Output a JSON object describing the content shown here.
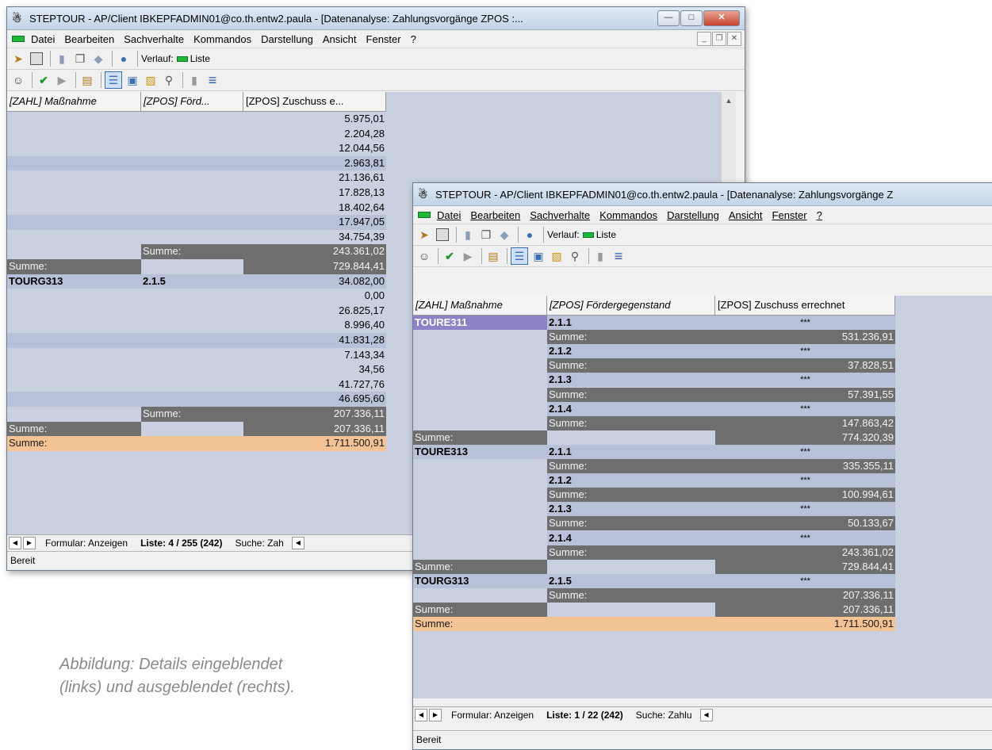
{
  "left_window": {
    "title": "STEPTOUR - AP/Client IBKEPFADMIN01@co.th.entw2.paula - [Datenanalyse: Zahlungsvorgänge ZPOS :...",
    "menu": [
      "Datei",
      "Bearbeiten",
      "Sachverhalte",
      "Kommandos",
      "Darstellung",
      "Ansicht",
      "Fenster",
      "?"
    ],
    "verlauf_label": "Verlauf:",
    "verlauf_value": "Liste",
    "columns": [
      "[ZAHL] Maßnahme",
      "[ZPOS] Förd...",
      "[ZPOS] Zuschuss e..."
    ],
    "rows": [
      {
        "c1": "",
        "c2": "",
        "c3": "5.975,01",
        "style": "lt"
      },
      {
        "c1": "",
        "c2": "",
        "c3": "2.204,28",
        "style": "lt"
      },
      {
        "c1": "",
        "c2": "",
        "c3": "12.044,56",
        "style": "lt"
      },
      {
        "c1": "",
        "c2": "",
        "c3": "2.963,81",
        "style": "st"
      },
      {
        "c1": "",
        "c2": "",
        "c3": "21.136,61",
        "style": "lt"
      },
      {
        "c1": "",
        "c2": "",
        "c3": "17.828,13",
        "style": "lt"
      },
      {
        "c1": "",
        "c2": "",
        "c3": "18.402,64",
        "style": "lt"
      },
      {
        "c1": "",
        "c2": "",
        "c3": "17.947,05",
        "style": "st"
      },
      {
        "c1": "",
        "c2": "",
        "c3": "34.754,39",
        "style": "lt"
      },
      {
        "c1": "",
        "c2": "Summe:",
        "c3": "243.361,02",
        "style": "sum2"
      },
      {
        "c1": "Summe:",
        "c2": "",
        "c3": "729.844,41",
        "style": "sum1"
      },
      {
        "c1": "TOURG313",
        "c2": "2.1.5",
        "c3": "34.082,00",
        "style": "head"
      },
      {
        "c1": "",
        "c2": "",
        "c3": "0,00",
        "style": "lt"
      },
      {
        "c1": "",
        "c2": "",
        "c3": "26.825,17",
        "style": "lt"
      },
      {
        "c1": "",
        "c2": "",
        "c3": "8.996,40",
        "style": "lt"
      },
      {
        "c1": "",
        "c2": "",
        "c3": "41.831,28",
        "style": "st"
      },
      {
        "c1": "",
        "c2": "",
        "c3": "7.143,34",
        "style": "lt"
      },
      {
        "c1": "",
        "c2": "",
        "c3": "34,56",
        "style": "lt"
      },
      {
        "c1": "",
        "c2": "",
        "c3": "41.727,76",
        "style": "lt"
      },
      {
        "c1": "",
        "c2": "",
        "c3": "46.695,60",
        "style": "st"
      },
      {
        "c1": "",
        "c2": "Summe:",
        "c3": "207.336,11",
        "style": "sum2"
      },
      {
        "c1": "Summe:",
        "c2": "",
        "c3": "207.336,11",
        "style": "sum1"
      },
      {
        "c1": "Summe:",
        "c2": "",
        "c3": "1.711.500,91",
        "style": "total"
      }
    ],
    "tabs": {
      "form": "Formular: Anzeigen",
      "list": "Liste:  4 / 255 (242)",
      "search": "Suche: Zah"
    },
    "status": "Bereit"
  },
  "right_window": {
    "title": "STEPTOUR - AP/Client IBKEPFADMIN01@co.th.entw2.paula - [Datenanalyse: Zahlungsvorgänge Z",
    "menu": [
      "Datei",
      "Bearbeiten",
      "Sachverhalte",
      "Kommandos",
      "Darstellung",
      "Ansicht",
      "Fenster",
      "?"
    ],
    "verlauf_label": "Verlauf:",
    "verlauf_value": "Liste",
    "columns": [
      "[ZAHL] Maßnahme",
      "[ZPOS] Fördergegenstand",
      "[ZPOS] Zuschuss errechnet"
    ],
    "rows": [
      {
        "c1": "TOURE311",
        "c2": "2.1.1",
        "c3": "***",
        "style": "first"
      },
      {
        "c1": "",
        "c2": "Summe:",
        "c3": "531.236,91",
        "style": "sum2"
      },
      {
        "c1": "",
        "c2": "2.1.2",
        "c3": "***",
        "style": "sub"
      },
      {
        "c1": "",
        "c2": "Summe:",
        "c3": "37.828,51",
        "style": "sum2"
      },
      {
        "c1": "",
        "c2": "2.1.3",
        "c3": "***",
        "style": "sub"
      },
      {
        "c1": "",
        "c2": "Summe:",
        "c3": "57.391,55",
        "style": "sum2"
      },
      {
        "c1": "",
        "c2": "2.1.4",
        "c3": "***",
        "style": "sub"
      },
      {
        "c1": "",
        "c2": "Summe:",
        "c3": "147.863,42",
        "style": "sum2"
      },
      {
        "c1": "Summe:",
        "c2": "",
        "c3": "774.320,39",
        "style": "sum1"
      },
      {
        "c1": "TOURE313",
        "c2": "2.1.1",
        "c3": "***",
        "style": "head"
      },
      {
        "c1": "",
        "c2": "Summe:",
        "c3": "335.355,11",
        "style": "sum2"
      },
      {
        "c1": "",
        "c2": "2.1.2",
        "c3": "***",
        "style": "sub"
      },
      {
        "c1": "",
        "c2": "Summe:",
        "c3": "100.994,61",
        "style": "sum2"
      },
      {
        "c1": "",
        "c2": "2.1.3",
        "c3": "***",
        "style": "sub"
      },
      {
        "c1": "",
        "c2": "Summe:",
        "c3": "50.133,67",
        "style": "sum2"
      },
      {
        "c1": "",
        "c2": "2.1.4",
        "c3": "***",
        "style": "sub"
      },
      {
        "c1": "",
        "c2": "Summe:",
        "c3": "243.361,02",
        "style": "sum2"
      },
      {
        "c1": "Summe:",
        "c2": "",
        "c3": "729.844,41",
        "style": "sum1"
      },
      {
        "c1": "TOURG313",
        "c2": "2.1.5",
        "c3": "***",
        "style": "head"
      },
      {
        "c1": "",
        "c2": "Summe:",
        "c3": "207.336,11",
        "style": "sum2"
      },
      {
        "c1": "Summe:",
        "c2": "",
        "c3": "207.336,11",
        "style": "sum1"
      },
      {
        "c1": "Summe:",
        "c2": "",
        "c3": "1.711.500,91",
        "style": "total"
      }
    ],
    "tabs": {
      "form": "Formular: Anzeigen",
      "list": "Liste:  1 / 22 (242)",
      "search": "Suche: Zahlu"
    },
    "status": "Bereit"
  },
  "caption": {
    "line1": "Abbildung: Details eingeblendet",
    "line2": "(links) und ausgeblendet (rechts)."
  }
}
